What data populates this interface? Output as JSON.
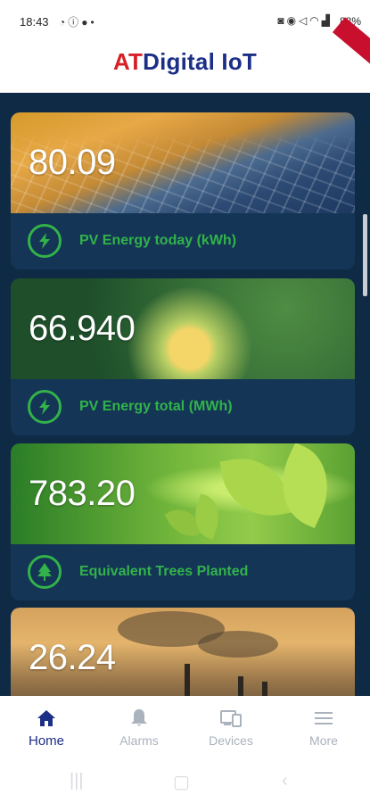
{
  "status_bar": {
    "time": "18:43",
    "battery": "88%",
    "left_icons": [
      "whatsapp-icon",
      "info-icon",
      "message-icon",
      "dot-icon"
    ],
    "right_icons": [
      "camera-icon",
      "alarm-icon",
      "mute-icon",
      "wifi-icon",
      "signal-icon"
    ]
  },
  "header": {
    "logo_prefix": "AT",
    "logo_suffix": "Digital IoT",
    "prefix_color": "#d62026",
    "suffix_color": "#1c2f86"
  },
  "cards": [
    {
      "value": "80.09",
      "label": "PV Energy today (kWh)",
      "icon": "bolt-icon",
      "image": "solar-panels"
    },
    {
      "value": "66.940",
      "label": "PV Energy total (MWh)",
      "icon": "bolt-icon",
      "image": "lightbulb-plant"
    },
    {
      "value": "783.20",
      "label": "Equivalent Trees Planted",
      "icon": "tree-icon",
      "image": "sprout-leaves"
    },
    {
      "value": "26.24",
      "label": "",
      "icon": "",
      "image": "smokestacks"
    }
  ],
  "bottom_nav": {
    "items": [
      {
        "label": "Home",
        "icon": "home-icon",
        "active": true
      },
      {
        "label": "Alarms",
        "icon": "bell-icon",
        "active": false
      },
      {
        "label": "Devices",
        "icon": "devices-icon",
        "active": false
      },
      {
        "label": "More",
        "icon": "menu-icon",
        "active": false
      }
    ]
  },
  "colors": {
    "background": "#0f2a45",
    "card": "#143556",
    "accent_green": "#32b34a",
    "active_nav": "#1c2f86",
    "inactive_nav": "#aab2bd"
  }
}
